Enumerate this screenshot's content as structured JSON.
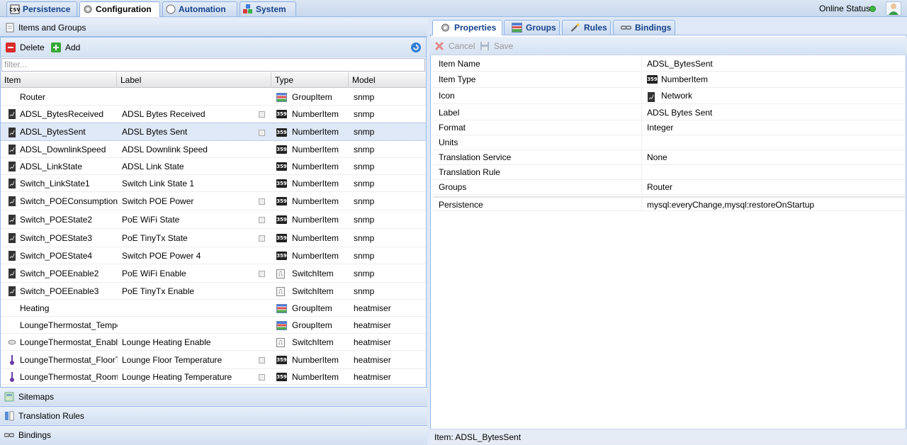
{
  "top_tabs": [
    {
      "label": "Persistence",
      "icon": "database-icon"
    },
    {
      "label": "Configuration",
      "icon": "gear-icon"
    },
    {
      "label": "Automation",
      "icon": "compass-icon"
    },
    {
      "label": "System",
      "icon": "blocks-icon"
    }
  ],
  "online_status": "Online Status",
  "left_panel": {
    "title": "Items and Groups",
    "toolbar": {
      "delete": "Delete",
      "add": "Add"
    },
    "filter_placeholder": "filter...",
    "columns": [
      "Item",
      "Label",
      "Type",
      "Model"
    ],
    "rows": [
      {
        "item": "Router",
        "label": "",
        "type": "GroupItem",
        "model": "snmp",
        "icon": "",
        "type_icon": "group",
        "btn": false
      },
      {
        "item": "ADSL_BytesReceived",
        "label": "ADSL Bytes Received",
        "type": "NumberItem",
        "model": "snmp",
        "icon": "network-icon",
        "type_icon": "number",
        "btn": true
      },
      {
        "item": "ADSL_BytesSent",
        "label": "ADSL Bytes Sent",
        "type": "NumberItem",
        "model": "snmp",
        "icon": "network-icon",
        "type_icon": "number",
        "btn": true
      },
      {
        "item": "ADSL_DownlinkSpeed",
        "label": "ADSL Downlink Speed",
        "type": "NumberItem",
        "model": "snmp",
        "icon": "network-icon",
        "type_icon": "number",
        "btn": false
      },
      {
        "item": "ADSL_LinkState",
        "label": "ADSL Link State",
        "type": "NumberItem",
        "model": "snmp",
        "icon": "network-icon",
        "type_icon": "number",
        "btn": false
      },
      {
        "item": "Switch_LinkState1",
        "label": "Switch Link State 1",
        "type": "NumberItem",
        "model": "snmp",
        "icon": "network-icon",
        "type_icon": "number",
        "btn": false
      },
      {
        "item": "Switch_POEConsumption",
        "label": "Switch POE Power",
        "type": "NumberItem",
        "model": "snmp",
        "icon": "network-icon",
        "type_icon": "number",
        "btn": true
      },
      {
        "item": "Switch_POEState2",
        "label": "PoE WiFi State",
        "type": "NumberItem",
        "model": "snmp",
        "icon": "network-icon",
        "type_icon": "number",
        "btn": true
      },
      {
        "item": "Switch_POEState3",
        "label": "PoE TinyTx State",
        "type": "NumberItem",
        "model": "snmp",
        "icon": "network-icon",
        "type_icon": "number",
        "btn": true
      },
      {
        "item": "Switch_POEState4",
        "label": "Switch POE Power 4",
        "type": "NumberItem",
        "model": "snmp",
        "icon": "network-icon",
        "type_icon": "number",
        "btn": false
      },
      {
        "item": "Switch_POEEnable2",
        "label": "PoE WiFi Enable",
        "type": "SwitchItem",
        "model": "snmp",
        "icon": "network-icon",
        "type_icon": "switch",
        "btn": true
      },
      {
        "item": "Switch_POEEnable3",
        "label": "PoE TinyTx Enable",
        "type": "SwitchItem",
        "model": "snmp",
        "icon": "network-icon",
        "type_icon": "switch",
        "btn": false
      },
      {
        "item": "Heating",
        "label": "",
        "type": "GroupItem",
        "model": "heatmiser",
        "icon": "",
        "type_icon": "group",
        "btn": false
      },
      {
        "item": "LoungeThermostat_Tempera",
        "label": "",
        "type": "GroupItem",
        "model": "heatmiser",
        "icon": "",
        "type_icon": "group",
        "btn": false
      },
      {
        "item": "LoungeThermostat_Enable",
        "label": "Lounge Heating Enable",
        "type": "SwitchItem",
        "model": "heatmiser",
        "icon": "switch-icon",
        "type_icon": "switch",
        "btn": false
      },
      {
        "item": "LoungeThermostat_FloorTer",
        "label": "Lounge Floor Temperature",
        "type": "NumberItem",
        "model": "heatmiser",
        "icon": "thermometer-icon",
        "type_icon": "number",
        "btn": true
      },
      {
        "item": "LoungeThermostat_RoomTer",
        "label": "Lounge Heating Temperature",
        "type": "NumberItem",
        "model": "heatmiser",
        "icon": "thermometer-icon",
        "type_icon": "number",
        "btn": true
      }
    ],
    "selected_index": 2
  },
  "accordion": [
    {
      "label": "Sitemaps",
      "icon": "sitemap-icon"
    },
    {
      "label": "Translation Rules",
      "icon": "translation-icon"
    },
    {
      "label": "Bindings",
      "icon": "binding-icon"
    }
  ],
  "right_tabs": [
    {
      "label": "Properties",
      "icon": "gear-icon"
    },
    {
      "label": "Groups",
      "icon": "group-icon"
    },
    {
      "label": "Rules",
      "icon": "wand-icon"
    },
    {
      "label": "Bindings",
      "icon": "link-icon"
    }
  ],
  "right_toolbar": {
    "cancel": "Cancel",
    "save": "Save"
  },
  "properties": [
    {
      "key": "Item Name",
      "value": "ADSL_BytesSent",
      "icon": ""
    },
    {
      "key": "Item Type",
      "value": "NumberItem",
      "icon": "number"
    },
    {
      "key": "Icon",
      "value": "Network",
      "icon": "network"
    },
    {
      "key": "Label",
      "value": "ADSL Bytes Sent",
      "icon": ""
    },
    {
      "key": "Format",
      "value": "Integer",
      "icon": ""
    },
    {
      "key": "Units",
      "value": "",
      "icon": ""
    },
    {
      "key": "Translation Service",
      "value": "None",
      "icon": ""
    },
    {
      "key": "Translation Rule",
      "value": "",
      "icon": ""
    },
    {
      "key": "Groups",
      "value": "Router",
      "icon": ""
    },
    {
      "key": "Persistence",
      "value": "mysql:everyChange,mysql:restoreOnStartup",
      "icon": ""
    }
  ],
  "status_bar": "Item: ADSL_BytesSent",
  "colors": {
    "header_blue": "#15428b",
    "border": "#99bbe8",
    "online_green": "#3fb43f"
  }
}
